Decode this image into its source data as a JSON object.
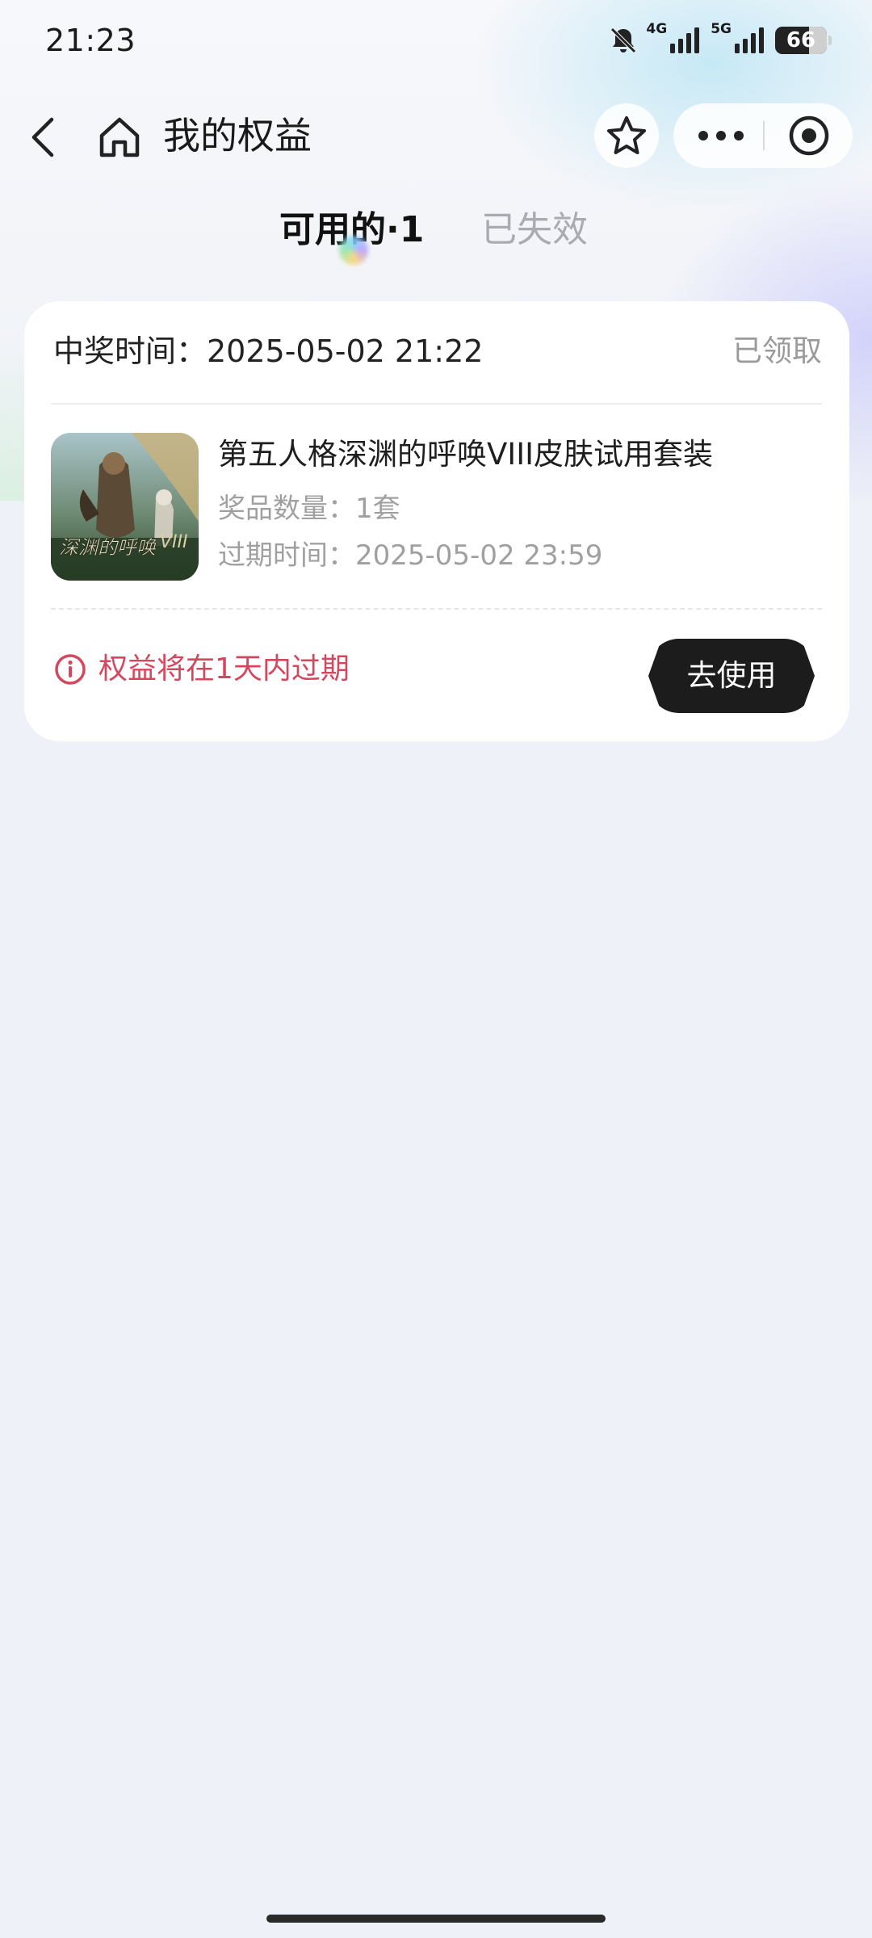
{
  "status_bar": {
    "time": "21:23",
    "net_4g": "4G",
    "net_5g": "5G",
    "battery": "66",
    "icons": [
      "silent-bell-icon",
      "signal-4g-icon",
      "signal-5g-icon",
      "battery-icon"
    ]
  },
  "nav": {
    "title": "我的权益",
    "icons": [
      "back-icon",
      "home-icon",
      "star-icon",
      "more-icon",
      "close-mini-program-icon"
    ]
  },
  "tabs": [
    {
      "label": "可用的·1",
      "active": true
    },
    {
      "label": "已失效",
      "active": false
    }
  ],
  "card": {
    "win_time_label": "中奖时间：2025-05-02 21:22",
    "status": "已领取",
    "prize": {
      "name": "第五人格深渊的呼唤VIII皮肤试用套装",
      "quantity": "奖品数量：1套",
      "expire": "过期时间：2025-05-02 23:59",
      "image_text": "深渊的呼唤"
    },
    "warning": "权益将在1天内过期",
    "use_button": "去使用"
  },
  "colors": {
    "background": "#eef1f7",
    "card": "#ffffff",
    "warning": "#d4485f",
    "button": "#1c1c1c",
    "tab_inactive": "#a9abb3"
  }
}
